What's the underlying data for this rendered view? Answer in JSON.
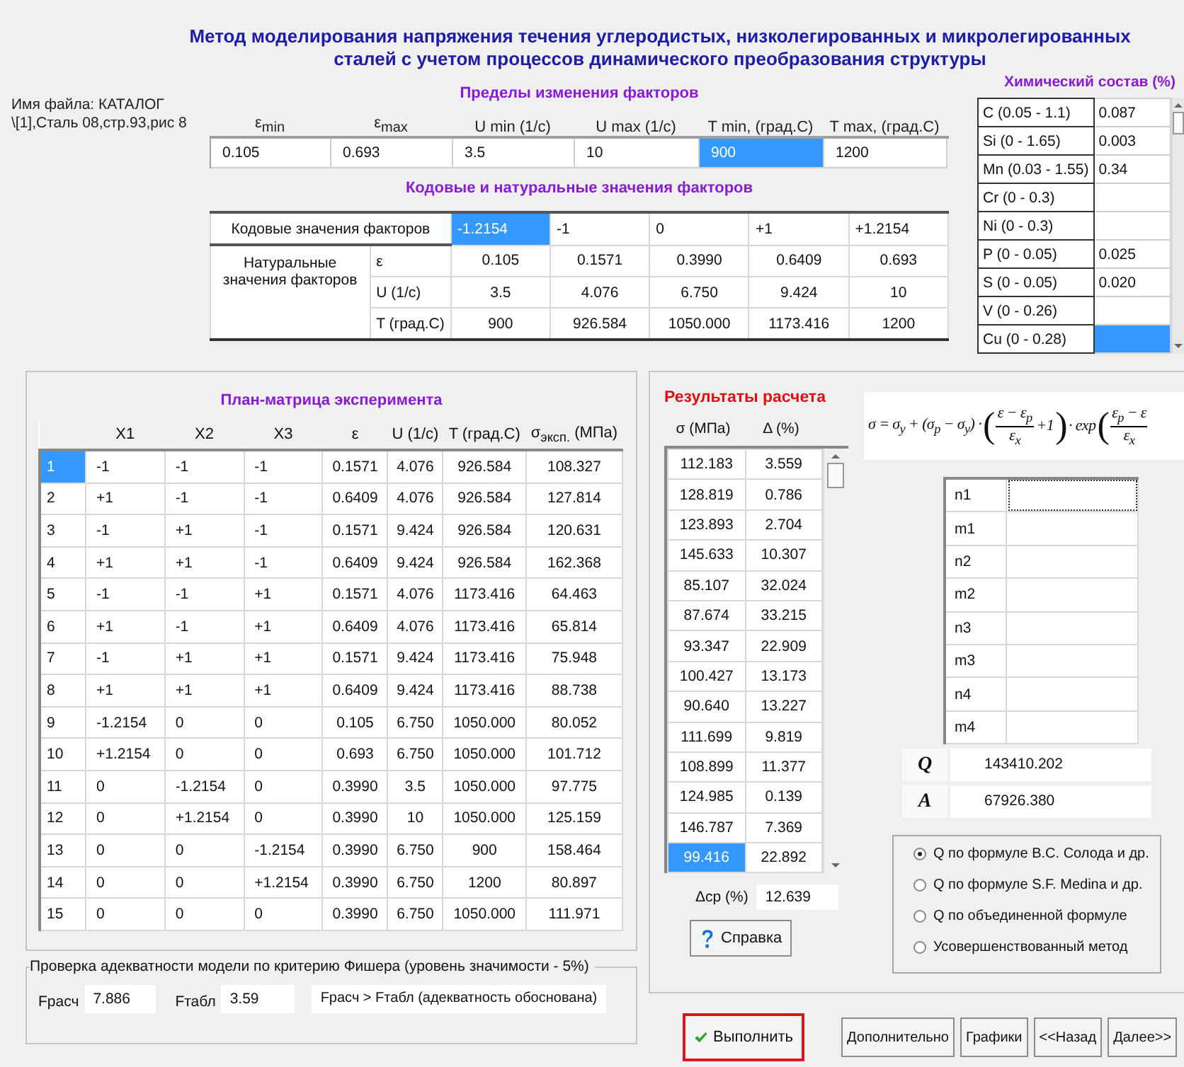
{
  "title_lines": [
    "Метод моделирования напряжения течения углеродистых, низколегированных и микролегированных",
    "сталей с учетом процессов динамического преобразования структуры"
  ],
  "file_info": [
    "Имя файла: КАТАЛОГ",
    "\\[1],Сталь 08,стр.93,рис 8"
  ],
  "factor_limits": {
    "title": "Пределы изменения факторов",
    "fields": [
      {
        "label": "ε$_{min}$",
        "value": "0.105",
        "selected": false
      },
      {
        "label": "ε$_{max}$",
        "value": "0.693",
        "selected": false
      },
      {
        "label": "U min (1/c)",
        "value": "3.5",
        "selected": false
      },
      {
        "label": "U max (1/c)",
        "value": "10",
        "selected": false
      },
      {
        "label": "T min, (град.С)",
        "value": "900",
        "selected": true
      },
      {
        "label": "T max, (град.С)",
        "value": "1200",
        "selected": false
      }
    ]
  },
  "factor_values": {
    "title": "Кодовые и натуральные значения факторов",
    "code_label": "Кодовые значения факторов",
    "codes": [
      {
        "value": "-1.2154",
        "selected": true
      },
      {
        "value": "-1",
        "selected": false
      },
      {
        "value": "0",
        "selected": false
      },
      {
        "value": "+1",
        "selected": false
      },
      {
        "value": "+1.2154",
        "selected": false
      }
    ],
    "natural_label": "Натуральные значения факторов",
    "rows": [
      {
        "name": "ε",
        "values": [
          "0.105",
          "0.1571",
          "0.3990",
          "0.6409",
          "0.693"
        ]
      },
      {
        "name": "U (1/c)",
        "values": [
          "3.5",
          "4.076",
          "6.750",
          "9.424",
          "10"
        ]
      },
      {
        "name": "T (град.С)",
        "values": [
          "900",
          "926.584",
          "1050.000",
          "1173.416",
          "1200"
        ]
      }
    ]
  },
  "chemistry": {
    "title": "Химический состав (%)",
    "rows": [
      {
        "element": "C (0.05 - 1.1)",
        "value": "0.087",
        "selected": false
      },
      {
        "element": "Si (0 - 1.65)",
        "value": "0.003",
        "selected": false
      },
      {
        "element": "Mn (0.03 - 1.55)",
        "value": "0.34",
        "selected": false
      },
      {
        "element": "Cr (0 - 0.3)",
        "selected": false
      },
      {
        "element": "Ni (0 - 0.3)",
        "selected": false
      },
      {
        "element": "P (0 - 0.05)",
        "value": "0.025",
        "selected": false
      },
      {
        "element": "S (0 - 0.05)",
        "value": "0.020",
        "selected": false
      },
      {
        "element": "V (0 - 0.26)",
        "selected": false
      },
      {
        "element": "Cu (0 - 0.28)",
        "selected": true
      }
    ]
  },
  "plan_matrix": {
    "title": "План-матрица эксперимента",
    "columns": [
      "X1",
      "X2",
      "X3",
      "ε",
      "U (1/c)",
      "T (град.С)",
      "σ$_{эксп.}$ (МПа)"
    ],
    "rows": [
      {
        "number": "1",
        "selected": true,
        "cells": [
          "-1",
          "-1",
          "-1",
          "0.1571",
          "4.076",
          "926.584",
          "108.327"
        ]
      },
      {
        "number": "2",
        "selected": false,
        "cells": [
          "+1",
          "-1",
          "-1",
          "0.6409",
          "4.076",
          "926.584",
          "127.814"
        ]
      },
      {
        "number": "3",
        "selected": false,
        "cells": [
          "-1",
          "+1",
          "-1",
          "0.1571",
          "9.424",
          "926.584",
          "120.631"
        ]
      },
      {
        "number": "4",
        "selected": false,
        "cells": [
          "+1",
          "+1",
          "-1",
          "0.6409",
          "9.424",
          "926.584",
          "162.368"
        ]
      },
      {
        "number": "5",
        "selected": false,
        "cells": [
          "-1",
          "-1",
          "+1",
          "0.1571",
          "4.076",
          "1173.416",
          "64.463"
        ]
      },
      {
        "number": "6",
        "selected": false,
        "cells": [
          "+1",
          "-1",
          "+1",
          "0.6409",
          "4.076",
          "1173.416",
          "65.814"
        ]
      },
      {
        "number": "7",
        "selected": false,
        "cells": [
          "-1",
          "+1",
          "+1",
          "0.1571",
          "9.424",
          "1173.416",
          "75.948"
        ]
      },
      {
        "number": "8",
        "selected": false,
        "cells": [
          "+1",
          "+1",
          "+1",
          "0.6409",
          "9.424",
          "1173.416",
          "88.738"
        ]
      },
      {
        "number": "9",
        "selected": false,
        "cells": [
          "-1.2154",
          "0",
          "0",
          "0.105",
          "6.750",
          "1050.000",
          "80.052"
        ]
      },
      {
        "number": "10",
        "selected": false,
        "cells": [
          "+1.2154",
          "0",
          "0",
          "0.693",
          "6.750",
          "1050.000",
          "101.712"
        ]
      },
      {
        "number": "11",
        "selected": false,
        "cells": [
          "0",
          "-1.2154",
          "0",
          "0.3990",
          "3.5",
          "1050.000",
          "97.775"
        ]
      },
      {
        "number": "12",
        "selected": false,
        "cells": [
          "0",
          "+1.2154",
          "0",
          "0.3990",
          "10",
          "1050.000",
          "125.159"
        ]
      },
      {
        "number": "13",
        "selected": false,
        "cells": [
          "0",
          "0",
          "-1.2154",
          "0.3990",
          "6.750",
          "900",
          "158.464"
        ]
      },
      {
        "number": "14",
        "selected": false,
        "cells": [
          "0",
          "0",
          "+1.2154",
          "0.3990",
          "6.750",
          "1200",
          "80.897"
        ]
      },
      {
        "number": "15",
        "selected": false,
        "cells": [
          "0",
          "0",
          "0",
          "0.3990",
          "6.750",
          "1050.000",
          "111.971"
        ]
      }
    ]
  },
  "fisher": {
    "title": "Проверка адекватности модели по критерию Фишера  (уровень значимости - 5%)",
    "f_calc_label": "Fрасч",
    "f_calc": "7.886",
    "f_table_label": "Fтабл",
    "f_table": "3.59",
    "conclusion": "Fрасч > Fтабл   (адекватность обоснована)"
  },
  "results": {
    "title": "Результаты расчета",
    "columns": [
      "σ (МПа)",
      "Δ (%)"
    ],
    "rows": [
      {
        "values": [
          "112.183",
          "3.559"
        ],
        "selected": false
      },
      {
        "values": [
          "128.819",
          "0.786"
        ],
        "selected": false
      },
      {
        "values": [
          "123.893",
          "2.704"
        ],
        "selected": false
      },
      {
        "values": [
          "145.633",
          "10.307"
        ],
        "selected": false
      },
      {
        "values": [
          "85.107",
          "32.024"
        ],
        "selected": false
      },
      {
        "values": [
          "87.674",
          "33.215"
        ],
        "selected": false
      },
      {
        "values": [
          "93.347",
          "22.909"
        ],
        "selected": false
      },
      {
        "values": [
          "100.427",
          "13.173"
        ],
        "selected": false
      },
      {
        "values": [
          "90.640",
          "13.227"
        ],
        "selected": false
      },
      {
        "values": [
          "111.699",
          "9.819"
        ],
        "selected": false
      },
      {
        "values": [
          "108.899",
          "11.377"
        ],
        "selected": false
      },
      {
        "values": [
          "124.985",
          "0.139"
        ],
        "selected": false
      },
      {
        "values": [
          "146.787",
          "7.369"
        ],
        "selected": false
      },
      {
        "values": [
          "99.416",
          "22.892"
        ],
        "selected": true
      }
    ]
  },
  "mean_deviation": {
    "label": "Δср (%)",
    "value": "12.639"
  },
  "help_button": "Справка",
  "formula": [
    {
      "kind": "text",
      "text": "σ = σ$_{y}$ + (σ$_{p}$ − σ$_{y}$) ·"
    },
    {
      "kind": "paren",
      "text": "("
    },
    {
      "kind": "fraction",
      "numerator": "ε − ε$_{p}$",
      "denominator": "ε$_{x}$"
    },
    {
      "kind": "text",
      "text": "+1"
    },
    {
      "kind": "paren",
      "text": ")"
    },
    {
      "kind": "text",
      "text": "· exp"
    },
    {
      "kind": "paren",
      "text": "("
    },
    {
      "kind": "fraction",
      "numerator": "ε$_{p}$ − ε",
      "denominator": "ε$_{x}$"
    }
  ],
  "coefficients": [
    {
      "name": "n1",
      "focused": true
    },
    {
      "name": "m1",
      "focused": false
    },
    {
      "name": "n2",
      "focused": false
    },
    {
      "name": "m2",
      "focused": false
    },
    {
      "name": "n3",
      "focused": false
    },
    {
      "name": "m3",
      "focused": false
    },
    {
      "name": "n4",
      "focused": false
    },
    {
      "name": "m4",
      "focused": false
    }
  ],
  "q_value": {
    "label": "Q",
    "value": "143410.202"
  },
  "a_value": {
    "label": "A",
    "value": "67926.380"
  },
  "methods": [
    {
      "label": "Q по формуле B.C. Солода и др.",
      "selected": true
    },
    {
      "label": "Q по формуле S.F. Medina и др.",
      "selected": false
    },
    {
      "label": "Q по объединенной формуле",
      "selected": false
    },
    {
      "label": "Усовершенствованный метод",
      "selected": false
    }
  ],
  "buttons": [
    {
      "label": "Выполнить",
      "kind": "run",
      "focused": true
    },
    {
      "label": "Дополнительно",
      "kind": "plain",
      "focused": false
    },
    {
      "label": "Графики",
      "kind": "plain",
      "focused": false
    },
    {
      "label": "<<Назад",
      "kind": "plain",
      "focused": false
    },
    {
      "label": "Далее>>",
      "kind": "plain",
      "focused": false
    }
  ]
}
